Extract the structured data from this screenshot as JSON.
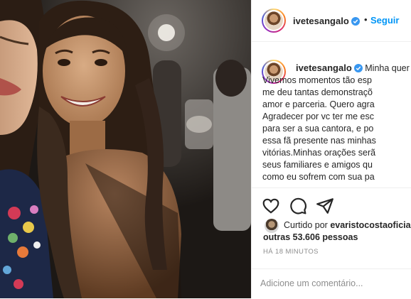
{
  "post": {
    "username": "ivetesangalo",
    "follow_label": "Seguir",
    "separator": "•",
    "caption_lines": [
      "Minha quer",
      "Vivemos momentos tão esp",
      "me deu tantas demonstraçõ",
      "amor e parceria. Quero agra",
      "Agradecer por vc ter me esc",
      "para ser a sua cantora, e po",
      "essa fã presente nas minhas",
      "vitórias.Minhas orações serã",
      "seus familiares e amigos qu",
      "como eu sofrem com sua pa"
    ],
    "liked_by_prefix": "Curtido por",
    "liked_by_user": "evaristocostaoficia",
    "liked_by_others": "outras 53.606 pessoas",
    "timestamp": "HÁ 18 MINUTOS",
    "comment_placeholder": "Adicione um comentário..."
  },
  "icons": {
    "verified": "verified-badge-icon",
    "like": "heart-icon",
    "comment": "comment-bubble-icon",
    "share": "paper-plane-icon"
  },
  "colors": {
    "link_blue": "#0095f6",
    "verified_blue": "#3897f0",
    "text_dark": "#262626",
    "text_muted": "#8e8e8e",
    "divider": "#efefef"
  }
}
